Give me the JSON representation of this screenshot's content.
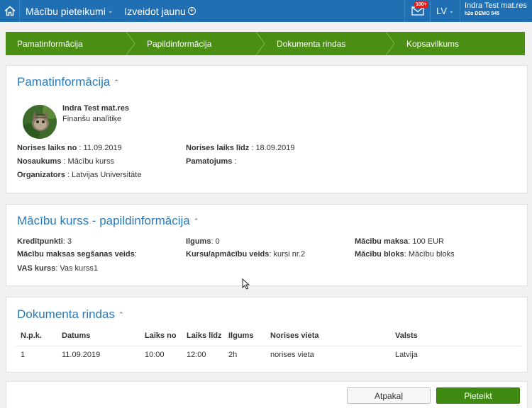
{
  "topbar": {
    "nav_main": "Mācību pieteikumi",
    "nav_create": "Izveidot jaunu",
    "mail_badge": "100+",
    "language": "LV",
    "user_name": "Indra Test mat.res",
    "user_org": "h2o DEMO 545"
  },
  "steps": [
    "Pamatinformācija",
    "Papildinformācija",
    "Dokumenta rindas",
    "Kopsavilkums"
  ],
  "basic": {
    "title": "Pamatinformācija",
    "person_name": "Indra Test mat.res",
    "person_role": "Finanšu analītiķe",
    "from_label": "Norises laiks no",
    "from_value": "11.09.2019",
    "to_label": "Norises laiks līdz",
    "to_value": "18.09.2019",
    "name_label": "Nosaukums",
    "name_value": "Mācību kurss",
    "justification_label": "Pamatojums",
    "justification_value": "",
    "organizer_label": "Organizators",
    "organizer_value": "Latvijas Universitāte"
  },
  "course": {
    "title": "Mācību kurss - papildinformācija",
    "credits_label": "Kredītpunkti",
    "credits_value": "3",
    "duration_label": "Ilgums",
    "duration_value": "0",
    "fee_label": "Mācību maksa",
    "fee_value": "100 EUR",
    "payment_label": "Mācību maksas segšanas veids",
    "payment_value": "",
    "course_type_label": "Kursu/apmācību veids",
    "course_type_value": "kursi nr.2",
    "block_label": "Mācību bloks",
    "block_value": "Mācību bloks",
    "vas_label": "VAS kurss",
    "vas_value": "Vas kurss1"
  },
  "doc": {
    "title": "Dokumenta rindas",
    "columns": [
      "N.p.k.",
      "Datums",
      "Laiks no",
      "Laiks līdz",
      "Ilgums",
      "Norises vieta",
      "Valsts"
    ],
    "rows": [
      [
        "1",
        "11.09.2019",
        "10:00",
        "12:00",
        "2h",
        "norises vieta",
        "Latvija"
      ]
    ]
  },
  "actions": {
    "back_label": "Atpakaļ",
    "submit_label": "Pieteikt"
  },
  "icons": {
    "home": "home-icon",
    "plus": "plus-circle-icon",
    "mail": "mail-icon",
    "chevron": "chevron-down-icon",
    "caret": "caret-up-icon"
  },
  "colors": {
    "topbar": "#1f6fb2",
    "stepper": "#4a8f14",
    "title": "#2a7ab8",
    "submit": "#3f8a11"
  }
}
